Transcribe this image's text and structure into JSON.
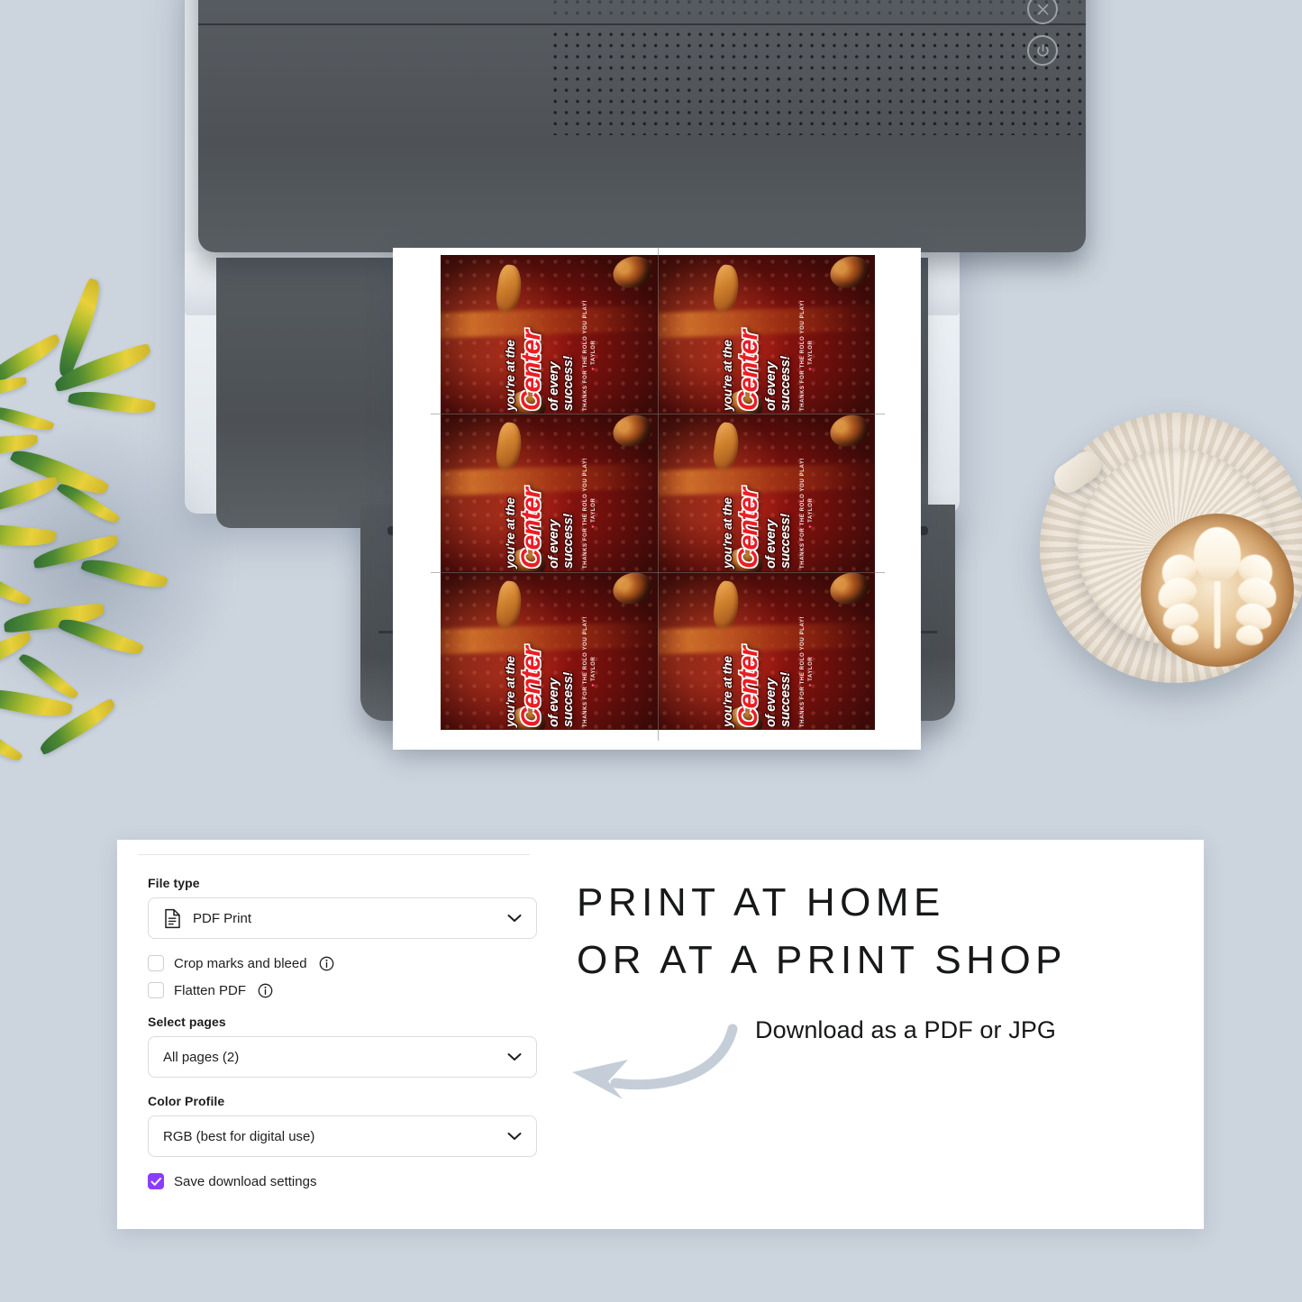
{
  "background_color": "#ccd4de",
  "scene": {
    "printer": {
      "body_color": "#55595e",
      "buttons": [
        {
          "name": "cancel",
          "icon": "close-icon"
        },
        {
          "name": "power",
          "icon": "power-icon"
        }
      ]
    },
    "props": [
      {
        "name": "potted-plant",
        "description": "variegated green and yellow leafy plant"
      },
      {
        "name": "latte-cup",
        "description": "ceramic ribbed cup and saucer with rosetta latte art"
      }
    ]
  },
  "printout": {
    "sheet_label": "printed sheet",
    "grid": {
      "columns": 2,
      "rows": 3,
      "total": 6
    },
    "card": {
      "line1": "you're at the",
      "highlight": "Center",
      "line3_a": "of every",
      "line3_b": "success!",
      "signature_line": "THANKS FOR THE ROLO YOU PLAY!",
      "signature_name": "TAYLOR",
      "heart": "♥",
      "colors": {
        "highlight": "#ec1c24",
        "text": "#ffffff",
        "background": "#6d0f0c",
        "heart": "#ff4d6d"
      }
    }
  },
  "panel": {
    "file_type": {
      "label": "File type",
      "value": "PDF Print",
      "icon": "document-icon",
      "chevron": "chevron-down-icon"
    },
    "checkboxes": [
      {
        "label": "Crop marks and bleed",
        "checked": false,
        "info": true
      },
      {
        "label": "Flatten PDF",
        "checked": false,
        "info": true
      }
    ],
    "select_pages": {
      "label": "Select pages",
      "value": "All pages (2)",
      "chevron": "chevron-down-icon"
    },
    "color_profile": {
      "label": "Color Profile",
      "value": "RGB (best for digital use)",
      "chevron": "chevron-down-icon"
    },
    "save_settings": {
      "label": "Save download settings",
      "checked": true,
      "accent": "#8b3dff"
    }
  },
  "marketing": {
    "headline_line1": "PRINT AT HOME",
    "headline_line2": "OR AT A PRINT SHOP",
    "subline": "Download as a PDF or JPG",
    "arrow": {
      "name": "curved-left-arrow",
      "color": "#c5ced8"
    }
  }
}
